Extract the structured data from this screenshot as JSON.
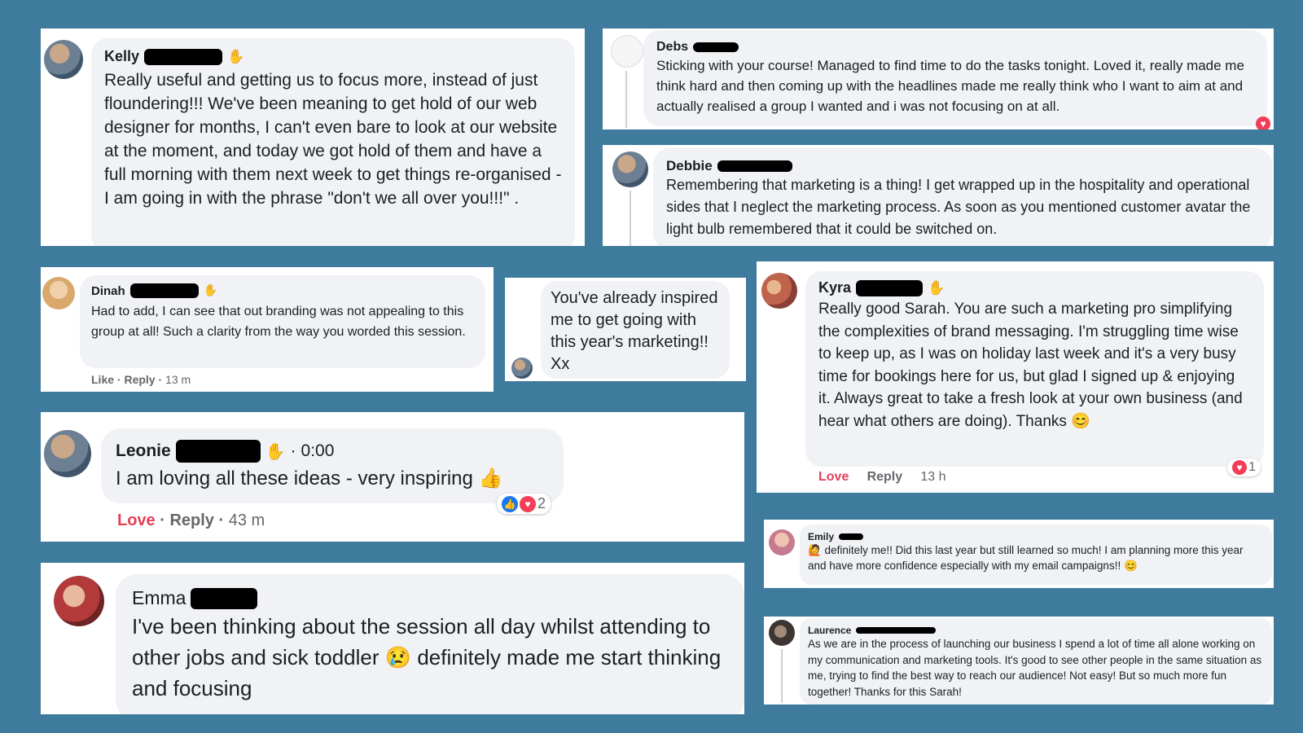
{
  "colors": {
    "background": "#3f7b9d",
    "bubble": "#f0f2f5",
    "love": "#e4405a",
    "like": "#1877f2"
  },
  "comments": {
    "kelly": {
      "name": "Kelly",
      "text": "Really useful and getting us to focus more, instead of just floundering!!! We've been meaning to get hold of our web designer for months, I can't even bare to look at our website at the moment, and today we got hold of them and have a full morning with them next week to get things re-organised - I am going in with the phrase \"don't we all over you!!!\" ."
    },
    "debs": {
      "name": "Debs",
      "text": "Sticking with your course! Managed to find time to do the tasks tonight. Loved it, really made me think hard and then coming up with the headlines made me really think who I want to aim at and actually realised a group I wanted and i was not focusing on at all."
    },
    "debbie": {
      "name": "Debbie",
      "text": "Remembering that marketing is a thing! I get wrapped up in the hospitality and operational sides that I neglect the marketing process. As soon as you mentioned customer avatar the light bulb remembered that it could be switched on."
    },
    "dinah": {
      "name": "Dinah",
      "text": "Had to add, I can see that out branding was not appealing to this group at all! Such a clarity from the way you worded this session.",
      "like": "Like",
      "reply": "Reply",
      "time": "13 m"
    },
    "anon": {
      "text": "You've already inspired me to get going with this year's marketing!! Xx"
    },
    "kyra": {
      "name": "Kyra",
      "text": "Really good Sarah. You are such a marketing pro simplifying the complexities of brand messaging. I'm struggling time wise to keep up, as I was on holiday last week and it's a very busy time for bookings here for us, but glad I signed up & enjoying it. Always great to take a fresh look at your own business (and hear what others are doing). Thanks 😊",
      "love": "Love",
      "reply": "Reply",
      "time": "13 h",
      "reactions": "1"
    },
    "leonie": {
      "name": "Leonie",
      "duration": "0:00",
      "text": "I am loving all these ideas - very inspiring 👍",
      "love": "Love",
      "reply": "Reply",
      "time": "43 m",
      "reactions": "2"
    },
    "emily": {
      "name": "Emily",
      "text": "🙋 definitely me!! Did this last year but still learned so much! I am planning more this year and have more confidence especially with my email campaigns!! 😊"
    },
    "emma": {
      "name": "Emma",
      "text": "I've been thinking about the session all day whilst attending to other jobs and sick toddler 😢 definitely made me start thinking and focusing"
    },
    "laurence": {
      "name": "Laurence",
      "text": "As we are in the process of launching our business I spend a lot of time all alone working on my communication and marketing tools. It's good to see other people in the same situation as me, trying to find the best way to reach our audience! Not easy! But so much more fun together! Thanks for this Sarah!"
    }
  },
  "icons": {
    "wave": "wave-icon",
    "heart": "heart-icon",
    "like": "like-icon"
  }
}
